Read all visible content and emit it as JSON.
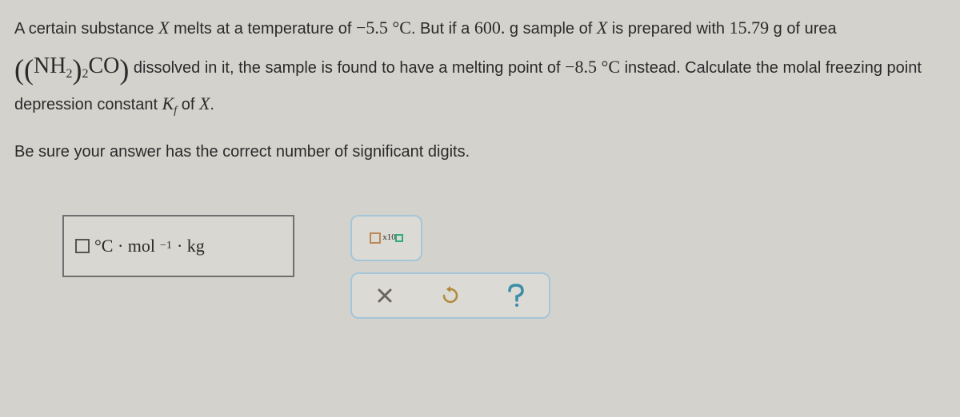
{
  "question": {
    "t1": "A certain substance ",
    "X1": "X",
    "t2": " melts at a temperature of ",
    "temp1": "−5.5 °C",
    "t3": ". But if a ",
    "mass_sample": "600.",
    "t4": " g sample of ",
    "X2": "X",
    "t5": " is prepared with ",
    "mass_urea": "15.79",
    "t6": " g of urea ",
    "formula_open": "(",
    "formula_inner_open": "(",
    "formula_NH": "NH",
    "formula_nh_sub": "2",
    "formula_inner_close": ")",
    "formula_outer_sub": "2",
    "formula_CO": "CO",
    "formula_close": ")",
    "t7": " dissolved in it, the sample is found to have a melting point of ",
    "temp2": "−8.5 °C",
    "t8": " instead. Calculate the molal freezing point depression constant ",
    "Kf_K": "K",
    "Kf_f": "f",
    "t9": " of ",
    "X3": "X",
    "t10": "."
  },
  "instruction": "Be sure your answer has the correct number of significant digits.",
  "answer_unit": {
    "deg": "°C · mol",
    "exp": "−1",
    "kg": " · kg"
  },
  "sci_label_base": "x10"
}
